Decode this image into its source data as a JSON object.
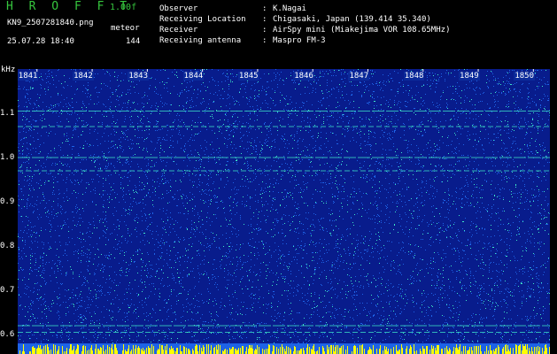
{
  "app": {
    "title": "H R O F F T",
    "version": "1.00f",
    "filename": "KN9_2507281840.png",
    "mode": "meteor",
    "datetime": "25.07.28 18:40",
    "count": "144"
  },
  "info": [
    {
      "key": "Observer",
      "value": "K.Nagai"
    },
    {
      "key": "Receiving Location",
      "value": "Chigasaki, Japan (139.414 35.340)"
    },
    {
      "key": "Receiver",
      "value": "AirSpy mini (Miakejima VOR 108.65MHz)"
    },
    {
      "key": "Receiving antenna",
      "value": "Maspro FM-3"
    }
  ],
  "info_sep": ":",
  "y_unit": "kHz",
  "chart_data": {
    "type": "heatmap",
    "y_ticks": [
      "1.1",
      "1.0",
      "0.9",
      "0.8",
      "0.7",
      "0.6"
    ],
    "y_values": [
      1.1,
      1.0,
      0.9,
      0.8,
      0.7,
      0.6
    ],
    "ylim": [
      0.58,
      1.2
    ],
    "x_ticks": [
      "1841",
      "1842",
      "1843",
      "1844",
      "1845",
      "1846",
      "1847",
      "1848",
      "1849",
      "1850"
    ],
    "x_values": [
      1841,
      1842,
      1843,
      1844,
      1845,
      1846,
      1847,
      1848,
      1849,
      1850
    ],
    "xlim": [
      1840.65,
      1850.3
    ],
    "traces_khz": [
      1.105,
      1.07,
      1.0,
      0.97,
      0.62,
      0.605
    ],
    "colors": {
      "background": "#081c8c",
      "noise": "#1e63e6",
      "signal": "#3ee6c8",
      "peak": "#ffff00"
    }
  }
}
